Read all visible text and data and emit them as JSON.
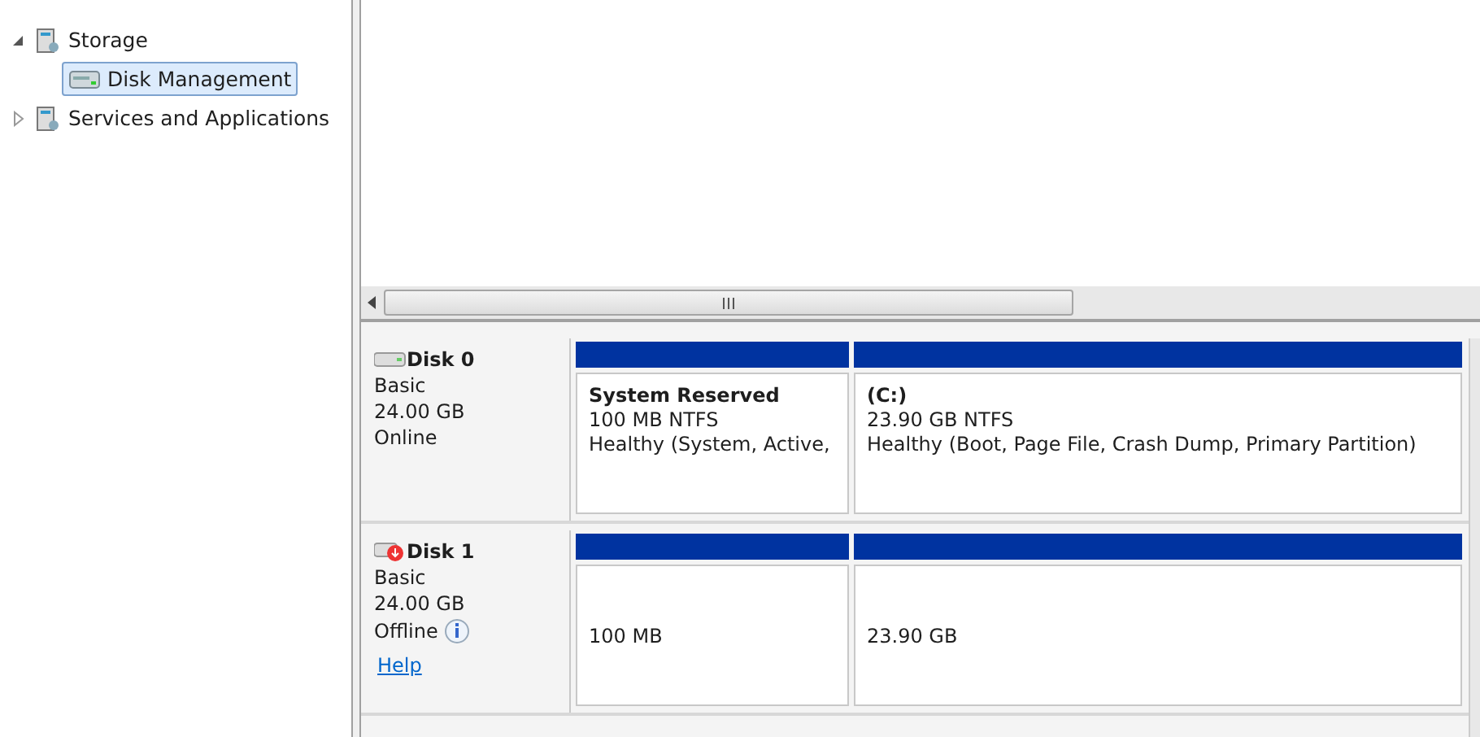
{
  "tree": [
    {
      "label": "Storage",
      "expanded": true,
      "selected": false,
      "children": [
        {
          "label": "Disk Management",
          "selected": true
        }
      ]
    },
    {
      "label": "Services and Applications",
      "expanded": false,
      "selected": false
    }
  ],
  "disks": [
    {
      "name": "Disk 0",
      "type": "Basic",
      "size": "24.00 GB",
      "status": "Online",
      "offline": false,
      "partitions": [
        {
          "title": "System Reserved",
          "size": "100 MB NTFS",
          "health": "Healthy (System, Active,"
        },
        {
          "title": "(C:)",
          "size": "23.90 GB NTFS",
          "health": "Healthy (Boot, Page File, Crash Dump, Primary Partition)"
        }
      ]
    },
    {
      "name": "Disk 1",
      "type": "Basic",
      "size": "24.00 GB",
      "status": "Offline",
      "offline": true,
      "link": "Help",
      "partitions": [
        {
          "size": "100 MB"
        },
        {
          "size": "23.90 GB"
        }
      ]
    }
  ]
}
